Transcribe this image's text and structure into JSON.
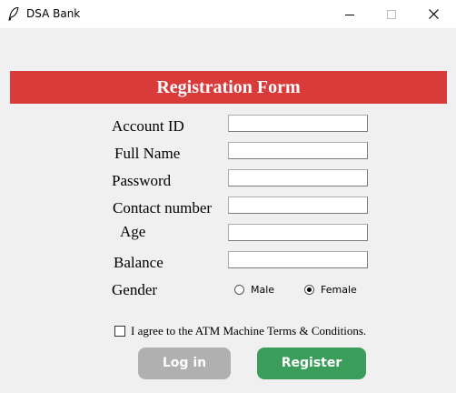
{
  "window": {
    "title": "DSA Bank",
    "icon": "feather-icon",
    "controls": [
      "minimize-icon",
      "maximize-icon",
      "close-icon"
    ]
  },
  "form": {
    "header_text": "Registration Form",
    "header_color": "#d93a3a",
    "fields": [
      {
        "label": "Account ID",
        "value": ""
      },
      {
        "label": "Full Name",
        "value": ""
      },
      {
        "label": "Password",
        "value": ""
      },
      {
        "label": "Contact number",
        "value": ""
      },
      {
        "label": "Age",
        "value": ""
      },
      {
        "label": "Balance",
        "value": ""
      }
    ],
    "gender": {
      "label": "Gender",
      "options": [
        {
          "label": "Male",
          "selected": false
        },
        {
          "label": "Female",
          "selected": true
        }
      ]
    },
    "terms": {
      "label": "I agree to the ATM Machine Terms & Conditions.",
      "checked": false
    },
    "buttons": {
      "login": {
        "label": "Log in",
        "color": "#b0b0b0"
      },
      "register": {
        "label": "Register",
        "color": "#3a9e5a"
      }
    }
  }
}
